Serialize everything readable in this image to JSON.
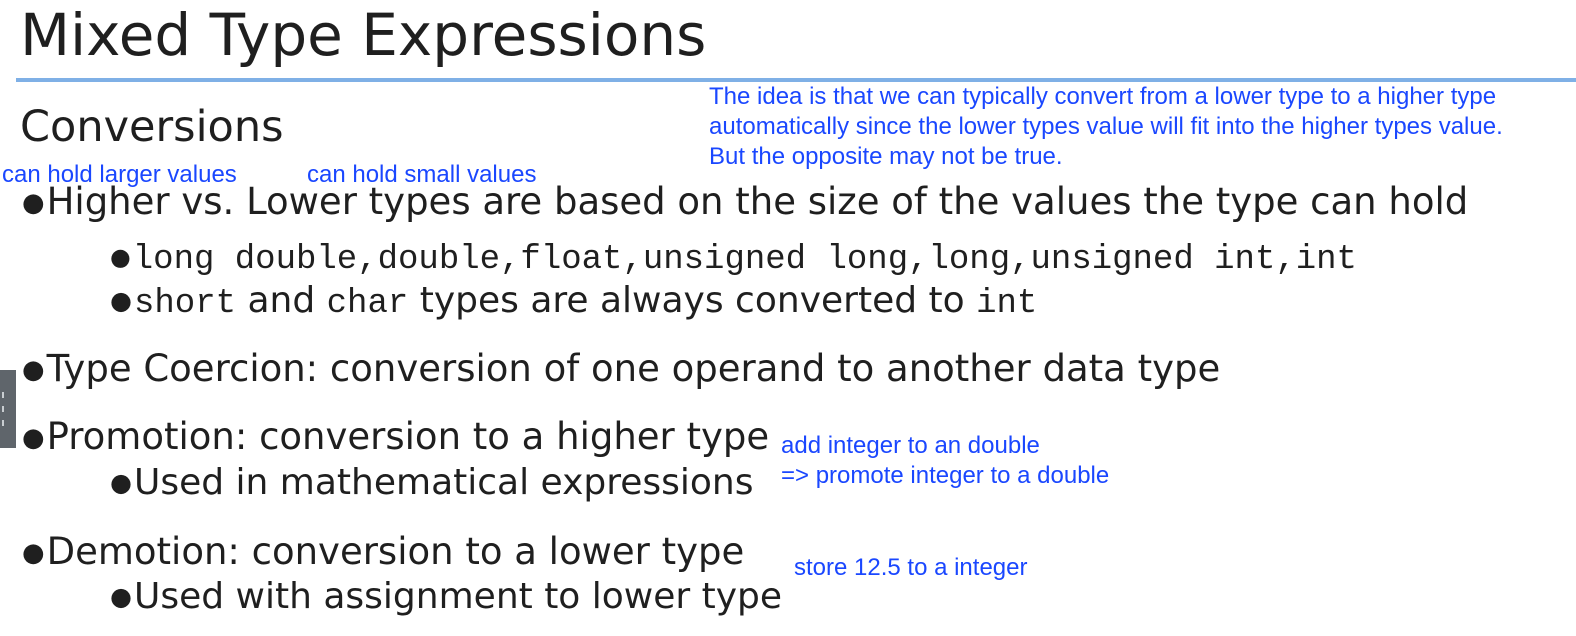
{
  "slide": {
    "title": "Mixed Type Expressions",
    "subtitle": "Conversions",
    "bullets": {
      "higher_lower": "Higher vs. Lower types are based on the size of the values the type can hold",
      "type_order": "long double,double,float,unsigned long,long,unsigned int,int",
      "short_char": {
        "t1": "short",
        "t2": " and ",
        "t3": "char",
        "t4": " types are always converted to ",
        "t5": "int"
      },
      "coercion": "Type Coercion: conversion of one operand to another data type",
      "promotion": "Promotion: conversion to a higher type",
      "promotion_use": "Used in mathematical expressions",
      "demotion": "Demotion: conversion to a lower type",
      "demotion_use": "Used with assignment to lower type"
    }
  },
  "annotations": {
    "idea_line1": "The idea is that we can typically convert from a lower type to a higher type",
    "idea_line2": "automatically since the lower types value will fit into the higher types value.",
    "idea_line3": "But the opposite may not be true.",
    "larger_values": "can hold larger values",
    "small_values": "can hold small values",
    "promote_line1": "add integer to an double",
    "promote_line2": "=> promote integer to a double",
    "demote_note": "store 12.5 to a integer"
  },
  "colors": {
    "annotation": "#1a47ff",
    "title_rule": "#7fb0e6",
    "text": "#1f1f1f"
  }
}
